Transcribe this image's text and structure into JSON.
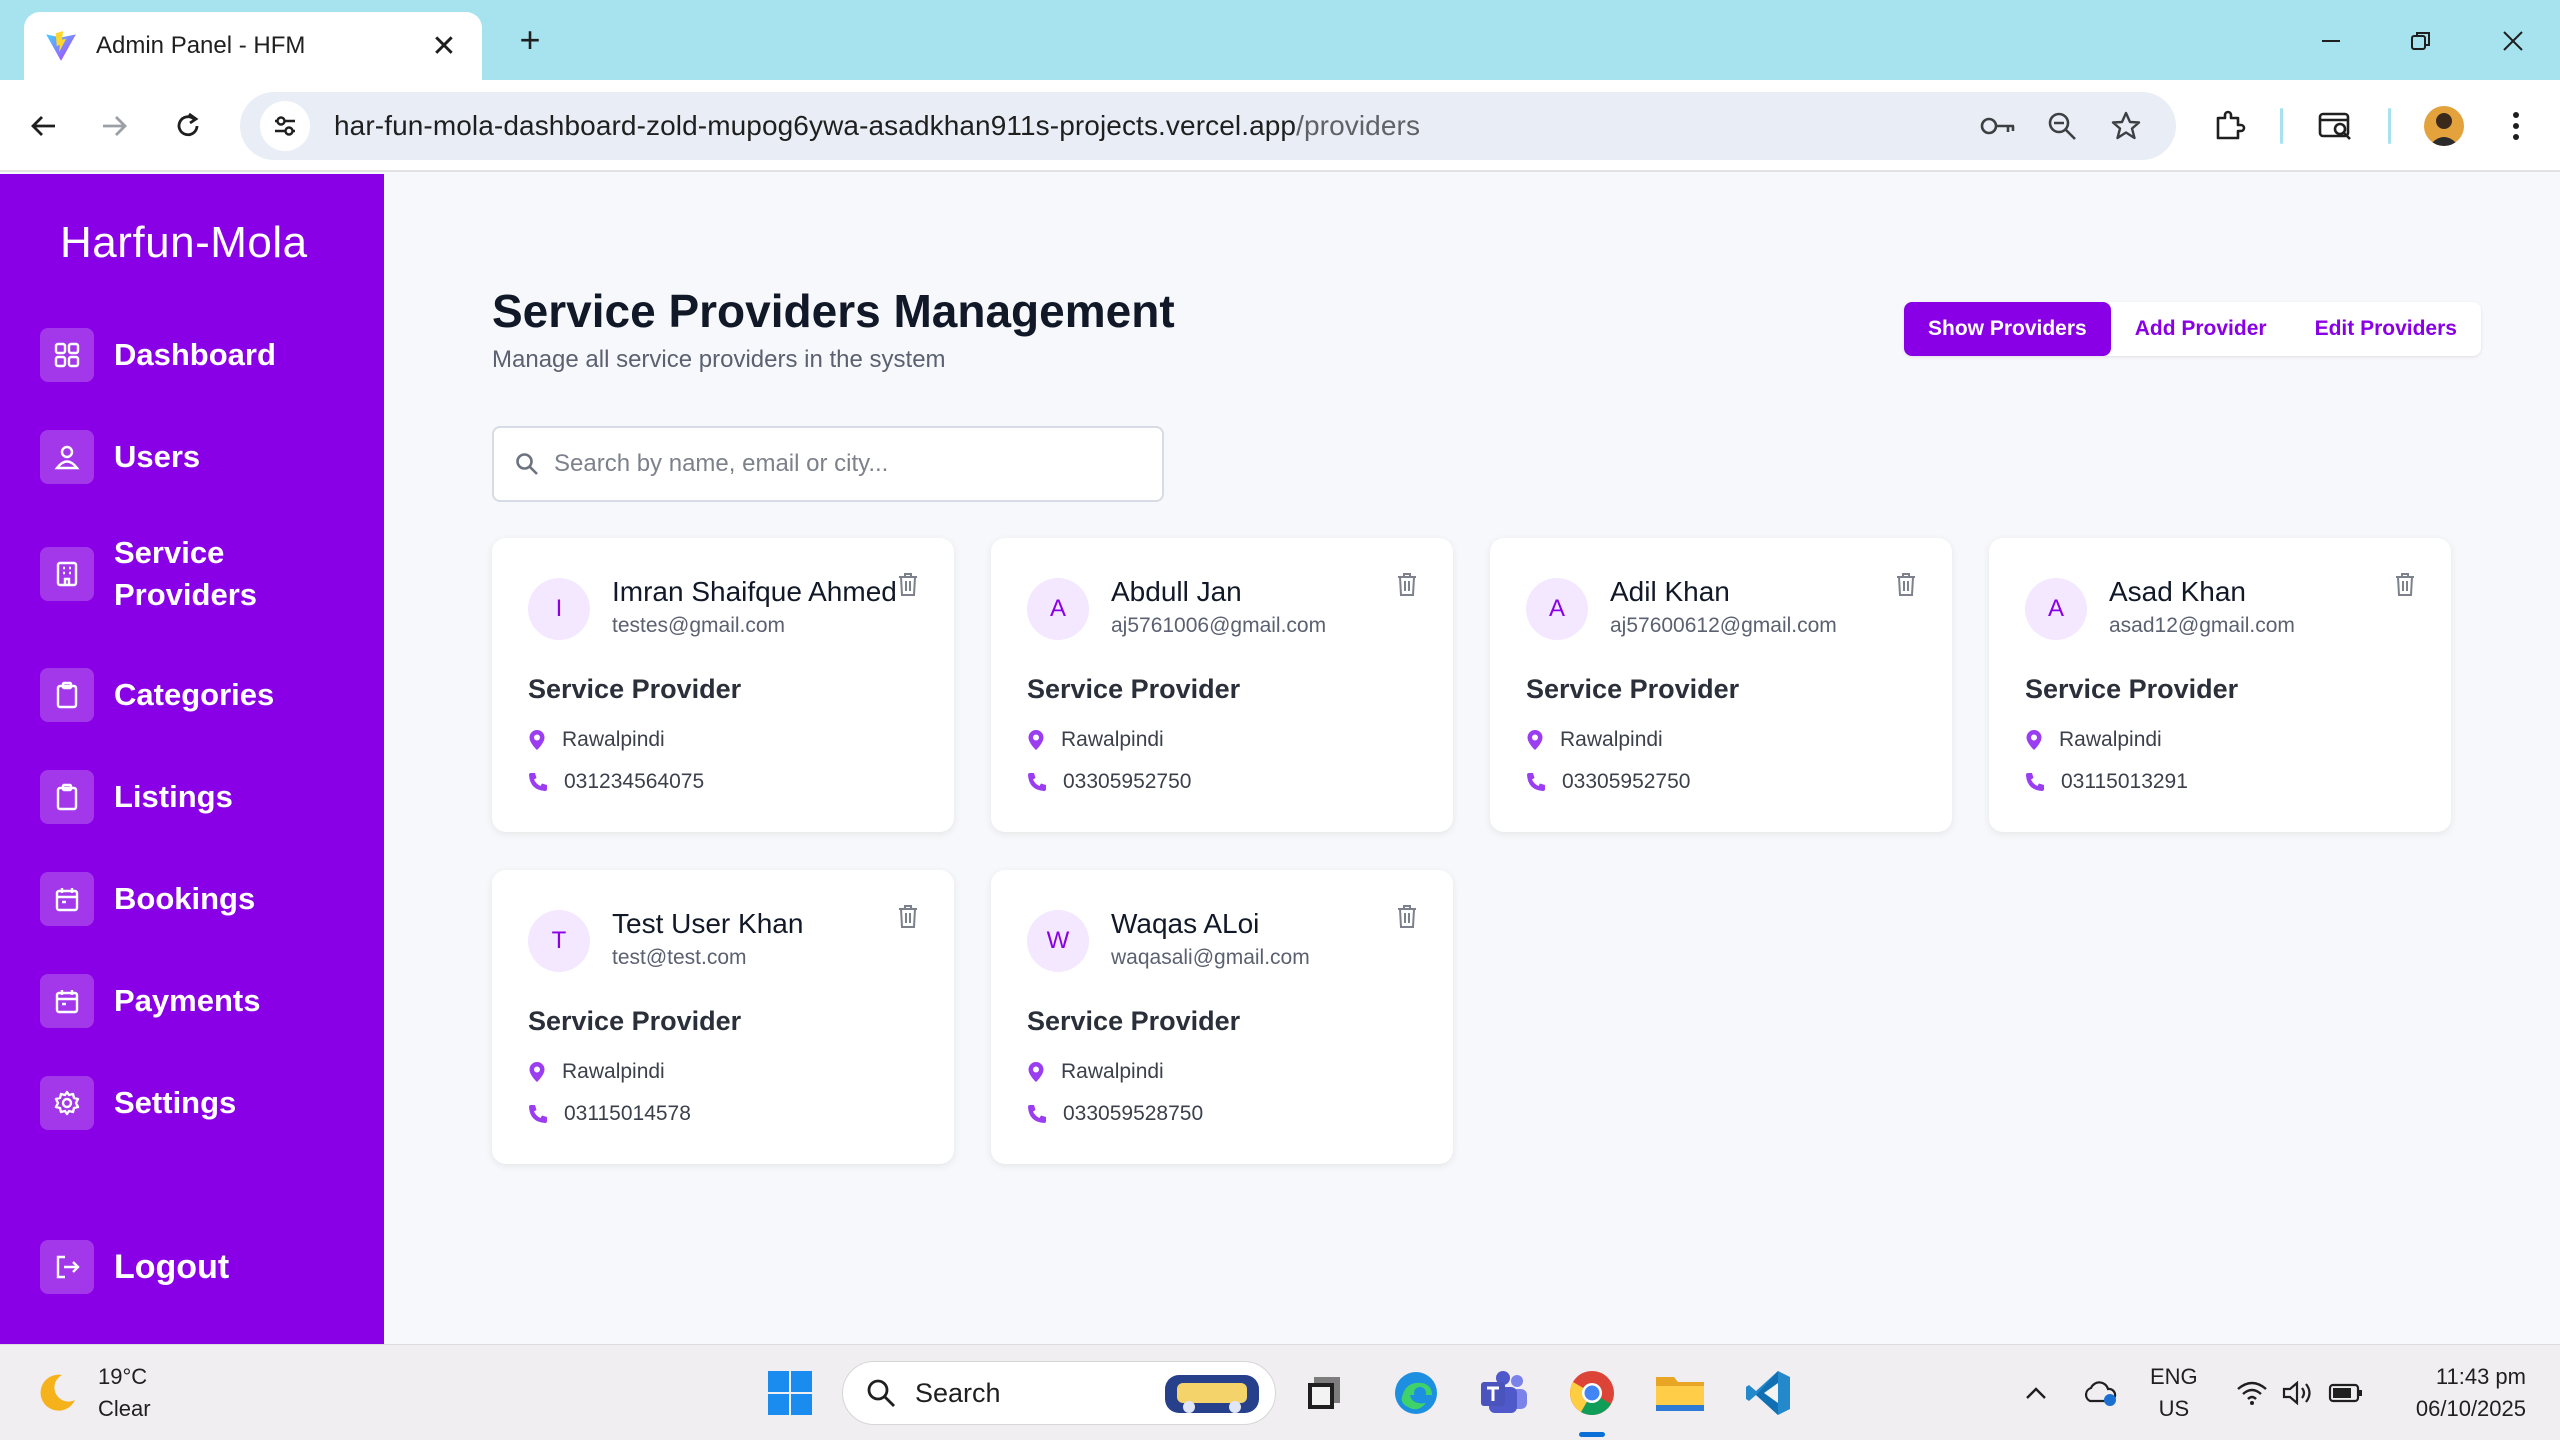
{
  "browser": {
    "tab_title": "Admin Panel - HFM",
    "url_host": "har-fun-mola-dashboard-zold-mupog6ywa-asadkhan911s-projects.vercel.app",
    "url_path": "/providers"
  },
  "sidebar": {
    "brand": "Harfun-Mola",
    "items": [
      {
        "label": "Dashboard",
        "icon": "grid-icon"
      },
      {
        "label": "Users",
        "icon": "users-icon"
      },
      {
        "label": "Service Providers",
        "icon": "building-icon"
      },
      {
        "label": "Categories",
        "icon": "clipboard-icon"
      },
      {
        "label": "Listings",
        "icon": "clipboard-icon"
      },
      {
        "label": "Bookings",
        "icon": "calendar-icon"
      },
      {
        "label": "Payments",
        "icon": "calendar-icon"
      },
      {
        "label": "Settings",
        "icon": "gear-icon"
      }
    ],
    "logout": "Logout"
  },
  "page": {
    "title": "Service Providers Management",
    "subtitle": "Manage all service providers in the system",
    "tabs": [
      "Show Providers",
      "Add Provider",
      "Edit Providers"
    ],
    "active_tab": "Show Providers",
    "search_placeholder": "Search by name, email or city..."
  },
  "providers": [
    {
      "initial": "I",
      "name": "Imran Shaifque Ahmed",
      "email": "testes@gmail.com",
      "role": "Service Provider",
      "city": "Rawalpindi",
      "phone": "031234564075"
    },
    {
      "initial": "A",
      "name": "Abdull Jan",
      "email": "aj5761006@gmail.com",
      "role": "Service Provider",
      "city": "Rawalpindi",
      "phone": "03305952750"
    },
    {
      "initial": "A",
      "name": "Adil Khan",
      "email": "aj57600612@gmail.com",
      "role": "Service Provider",
      "city": "Rawalpindi",
      "phone": "03305952750"
    },
    {
      "initial": "A",
      "name": "Asad Khan",
      "email": "asad12@gmail.com",
      "role": "Service Provider",
      "city": "Rawalpindi",
      "phone": "03115013291"
    },
    {
      "initial": "T",
      "name": "Test User Khan",
      "email": "test@test.com",
      "role": "Service Provider",
      "city": "Rawalpindi",
      "phone": "03115014578"
    },
    {
      "initial": "W",
      "name": "Waqas ALoi",
      "email": "waqasali@gmail.com",
      "role": "Service Provider",
      "city": "Rawalpindi",
      "phone": "033059528750"
    }
  ],
  "taskbar": {
    "temperature": "19°C",
    "condition": "Clear",
    "search_label": "Search",
    "lang_top": "ENG",
    "lang_bottom": "US",
    "time": "11:43 pm",
    "date": "06/10/2025"
  },
  "colors": {
    "accent": "#8a00e6",
    "sidebar_bg": "#8a00e6",
    "tabbar_bg": "#a6e3ee",
    "avatar_bg": "#f3e8ff"
  }
}
